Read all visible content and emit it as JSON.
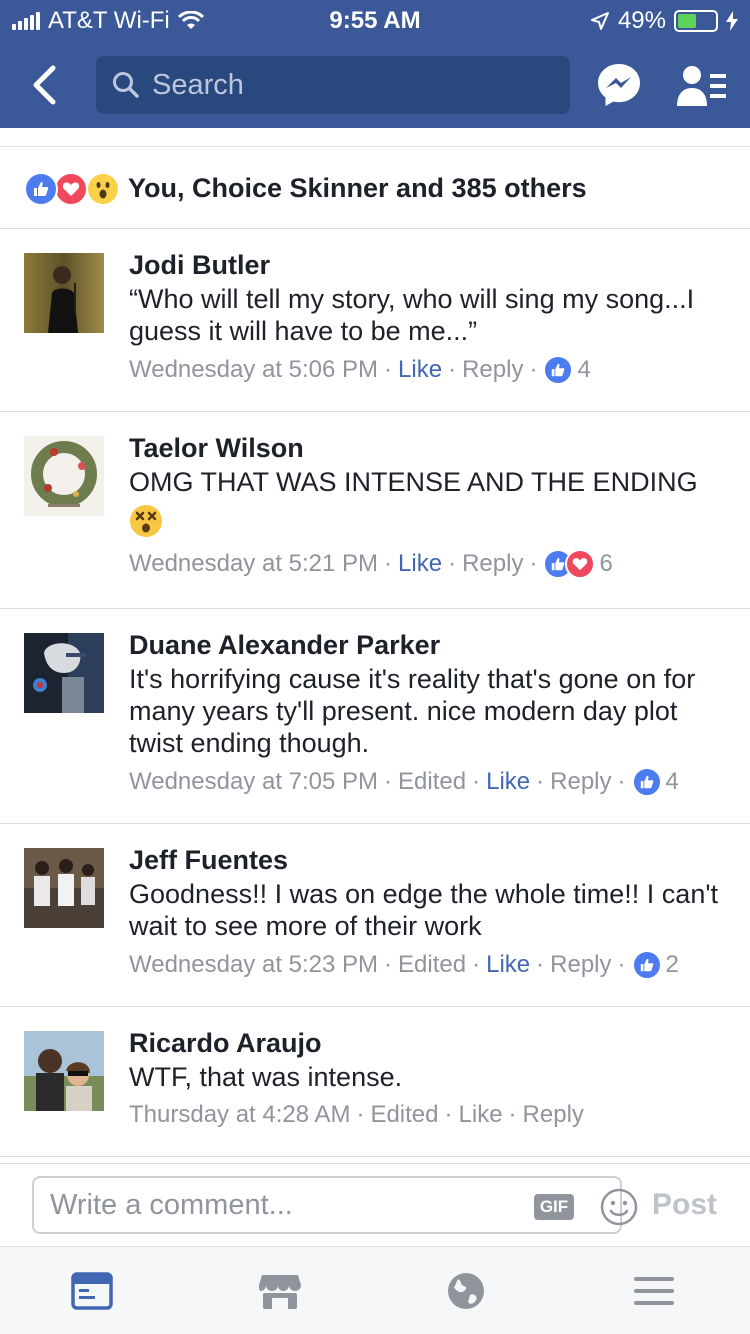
{
  "status_bar": {
    "carrier": "AT&T Wi-Fi",
    "time": "9:55 AM",
    "battery_percent": "49%",
    "battery_level": 0.49
  },
  "header": {
    "search_placeholder": "Search",
    "icons": [
      "back-chevron-icon",
      "search-icon",
      "messenger-icon",
      "friend-requests-icon"
    ]
  },
  "reactions": {
    "summary": "You, Choice Skinner and 385 others",
    "types": [
      "like",
      "love",
      "wow"
    ]
  },
  "comments": [
    {
      "name": "Jodi Butler",
      "text": "“Who will tell my story, who will sing my song...I guess it will have to be me...”",
      "timestamp": "Wednesday at 5:06 PM",
      "edited": "",
      "like_label": "Like",
      "reply_label": "Reply",
      "liked": true,
      "reaction_count": "4",
      "reactions": [
        "like"
      ]
    },
    {
      "name": "Taelor Wilson",
      "text": "OMG THAT WAS INTENSE AND THE ENDING",
      "emoji": "dizzy-face",
      "timestamp": "Wednesday at 5:21 PM",
      "edited": "",
      "like_label": "Like",
      "reply_label": "Reply",
      "liked": true,
      "reaction_count": "6",
      "reactions": [
        "like",
        "love"
      ]
    },
    {
      "name": "Duane Alexander Parker",
      "text": "It's horrifying cause it's reality that's gone on for many years ty'll present. nice modern day plot twist ending though.",
      "timestamp": "Wednesday at 7:05 PM",
      "edited": "Edited",
      "like_label": "Like",
      "reply_label": "Reply",
      "liked": true,
      "reaction_count": "4",
      "reactions": [
        "like"
      ]
    },
    {
      "name": "Jeff Fuentes",
      "text": "Goodness!! I was on edge the whole time!! I can't wait to see more of their work",
      "timestamp": "Wednesday at 5:23 PM",
      "edited": "Edited",
      "like_label": "Like",
      "reply_label": "Reply",
      "liked": true,
      "reaction_count": "2",
      "reactions": [
        "like"
      ]
    },
    {
      "name": "Ricardo Araujo",
      "text": "WTF, that was intense.",
      "timestamp": "Thursday at 4:28 AM",
      "edited": "Edited",
      "like_label": "Like",
      "reply_label": "Reply",
      "liked": false,
      "reaction_count": "",
      "reactions": []
    }
  ],
  "composer": {
    "placeholder": "Write a comment...",
    "gif_label": "GIF",
    "post_label": "Post"
  },
  "tabbar": {
    "tabs": [
      "news-feed-icon",
      "marketplace-icon",
      "notifications-globe-icon",
      "menu-icon"
    ],
    "active_tab": "news-feed-icon"
  },
  "colors": {
    "header_blue": "#3b5998",
    "like_blue": "#4267b2",
    "love_red": "#f0485d",
    "meta_gray": "#90949c"
  }
}
